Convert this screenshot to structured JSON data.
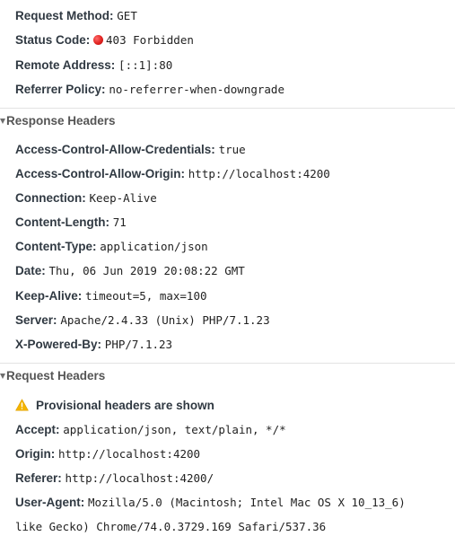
{
  "general": {
    "request_method": {
      "key": "Request Method:",
      "value": "GET"
    },
    "status_code": {
      "key": "Status Code:",
      "value": "403 Forbidden",
      "status_color": "#e0221f"
    },
    "remote_address": {
      "key": "Remote Address:",
      "value": "[::1]:80"
    },
    "referrer_policy": {
      "key": "Referrer Policy:",
      "value": "no-referrer-when-downgrade"
    }
  },
  "response_headers": {
    "title": "Response Headers",
    "items": [
      {
        "key": "Access-Control-Allow-Credentials:",
        "value": "true"
      },
      {
        "key": "Access-Control-Allow-Origin:",
        "value": "http://localhost:4200"
      },
      {
        "key": "Connection:",
        "value": "Keep-Alive"
      },
      {
        "key": "Content-Length:",
        "value": "71"
      },
      {
        "key": "Content-Type:",
        "value": "application/json"
      },
      {
        "key": "Date:",
        "value": "Thu, 06 Jun 2019 20:08:22 GMT"
      },
      {
        "key": "Keep-Alive:",
        "value": "timeout=5, max=100"
      },
      {
        "key": "Server:",
        "value": "Apache/2.4.33 (Unix) PHP/7.1.23"
      },
      {
        "key": "X-Powered-By:",
        "value": "PHP/7.1.23"
      }
    ]
  },
  "request_headers": {
    "title": "Request Headers",
    "warning": "Provisional headers are shown",
    "warning_icon": "warning-triangle-icon",
    "items": [
      {
        "key": "Accept:",
        "value": "application/json, text/plain, */*"
      },
      {
        "key": "Origin:",
        "value": "http://localhost:4200"
      },
      {
        "key": "Referer:",
        "value": "http://localhost:4200/"
      },
      {
        "key": "User-Agent:",
        "value": "Mozilla/5.0 (Macintosh; Intel Mac OS X 10_13_6)",
        "value_line2": "like Gecko) Chrome/74.0.3729.169 Safari/537.36"
      }
    ]
  }
}
